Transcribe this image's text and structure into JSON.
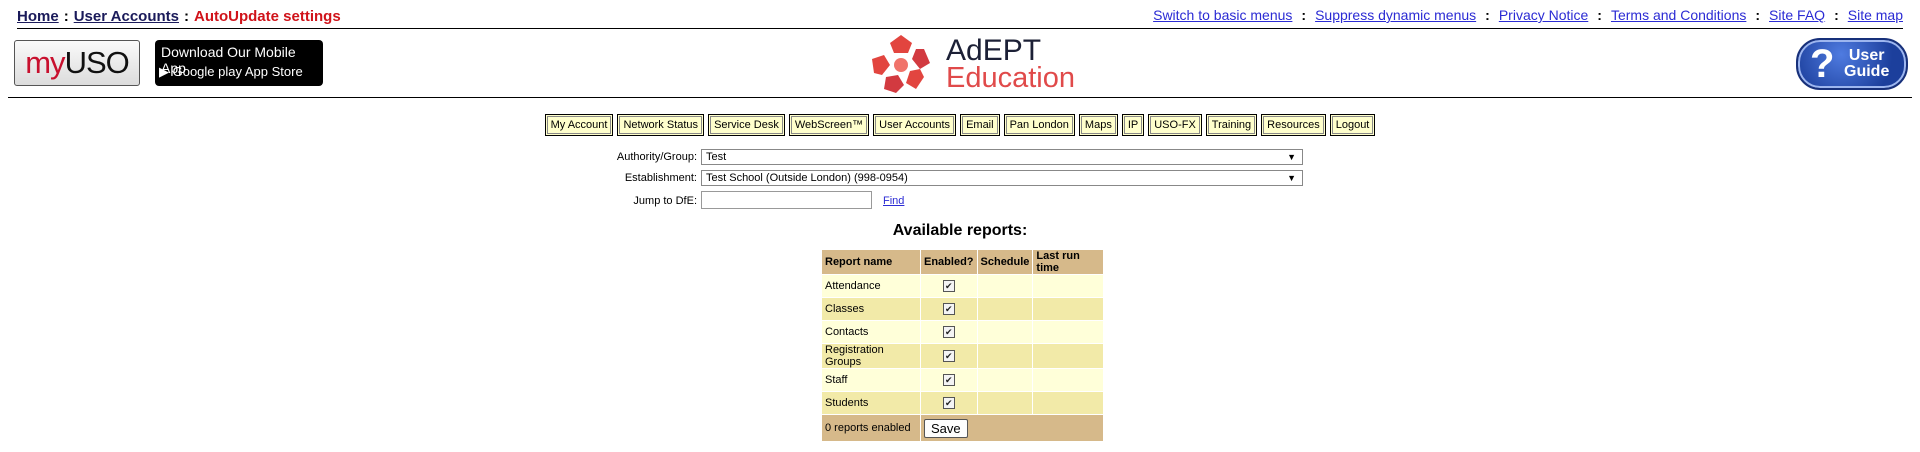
{
  "breadcrumb": {
    "home": "Home",
    "separator": ":",
    "user_accounts": "User Accounts",
    "current": "AutoUpdate settings"
  },
  "top_links": {
    "separator": ":",
    "items": [
      "Switch to basic menus",
      "Suppress dynamic menus",
      "Privacy Notice",
      "Terms and Conditions",
      "Site FAQ",
      "Site map"
    ]
  },
  "banner": {
    "myuso_my": "my",
    "myuso_uso": "USO",
    "app_badge_line1": "Download Our Mobile App",
    "app_badge_line2": "▶ Google play   App Store",
    "adept_name": "AdEPT",
    "adept_sub": "Education",
    "guide_q": "?",
    "guide_line1": "User",
    "guide_line2": "Guide"
  },
  "nav": [
    "My Account",
    "Network Status",
    "Service Desk",
    "WebScreen™",
    "User Accounts",
    "Email",
    "Pan London",
    "Maps",
    "IP",
    "USO-FX",
    "Training",
    "Resources",
    "Logout"
  ],
  "form": {
    "authority_label": "Authority/Group:",
    "authority_value": "Test",
    "establishment_label": "Establishment:",
    "establishment_value": "Test School (Outside London) (998-0954)",
    "jump_label": "Jump to DfE:",
    "jump_value": "",
    "find_label": "Find",
    "dropdown_arrow": "▼"
  },
  "reports": {
    "title": "Available reports:",
    "columns": [
      "Report name",
      "Enabled?",
      "Schedule",
      "Last run time"
    ],
    "rows": [
      {
        "name": "Attendance",
        "enabled": "✔",
        "schedule": "",
        "last_run": ""
      },
      {
        "name": "Classes",
        "enabled": "✔",
        "schedule": "",
        "last_run": ""
      },
      {
        "name": "Contacts",
        "enabled": "✔",
        "schedule": "",
        "last_run": ""
      },
      {
        "name": "Registration Groups",
        "enabled": "✔",
        "schedule": "",
        "last_run": ""
      },
      {
        "name": "Staff",
        "enabled": "✔",
        "schedule": "",
        "last_run": ""
      },
      {
        "name": "Students",
        "enabled": "✔",
        "schedule": "",
        "last_run": ""
      }
    ],
    "footer_text": "0 reports enabled",
    "save_label": "Save"
  },
  "colors": {
    "header_bg": "#d6b98a",
    "row_light": "#ffffd9",
    "row_dark": "#f2eaa8",
    "nav_bg": "#ffffcc",
    "crumb_current": "#d0131a",
    "link": "#2b2bd4"
  }
}
